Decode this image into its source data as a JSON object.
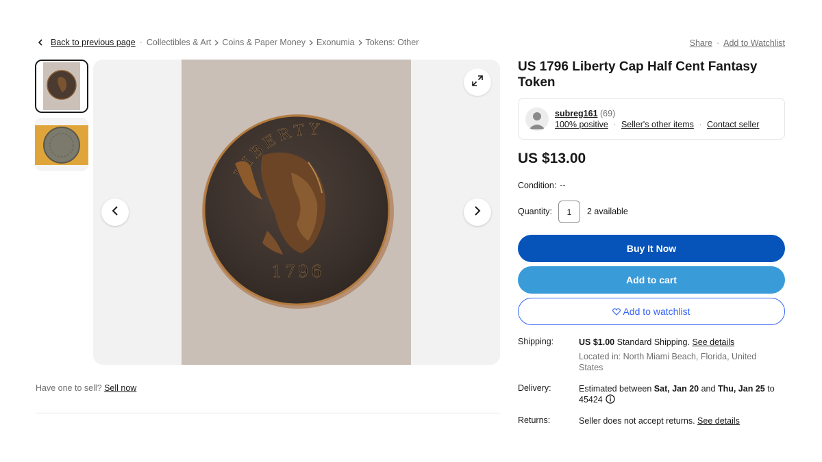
{
  "breadcrumb": {
    "back_label": "Back to previous page",
    "items": [
      "Collectibles & Art",
      "Coins & Paper Money",
      "Exonumia",
      "Tokens: Other"
    ]
  },
  "top_actions": {
    "share_label": "Share",
    "watchlist_label": "Add to Watchlist"
  },
  "gallery": {
    "coin_legend": "LIBERTY",
    "coin_date": "1796"
  },
  "sell": {
    "prompt": "Have one to sell?",
    "link": "Sell now"
  },
  "listing": {
    "title": "US 1796 Liberty Cap Half Cent Fantasy Token",
    "price": "US $13.00",
    "condition_label": "Condition:",
    "condition_value": "--",
    "quantity_label": "Quantity:",
    "quantity_value": "1",
    "available": "2 available"
  },
  "seller": {
    "name": "subreg161",
    "feedback_count": "(69)",
    "positive": "100% positive",
    "other_items": "Seller's other items",
    "contact": "Contact seller"
  },
  "buttons": {
    "buy_now": "Buy It Now",
    "add_to_cart": "Add to cart",
    "add_to_watchlist": "Add to watchlist"
  },
  "shipping": {
    "label": "Shipping:",
    "amount": "US $1.00",
    "method": "Standard Shipping.",
    "details_link": "See details",
    "location": "Located in: North Miami Beach, Florida, United States"
  },
  "delivery": {
    "label": "Delivery:",
    "prefix": "Estimated between",
    "date_start": "Sat, Jan 20",
    "and": "and",
    "date_end": "Thu, Jan 25",
    "to": "to",
    "zip": "45424"
  },
  "returns": {
    "label": "Returns:",
    "text": "Seller does not accept returns.",
    "details_link": "See details"
  },
  "colors": {
    "buy_button": "#0654ba",
    "cart_button": "#3a9bd9",
    "watch_border": "#3665f3"
  }
}
